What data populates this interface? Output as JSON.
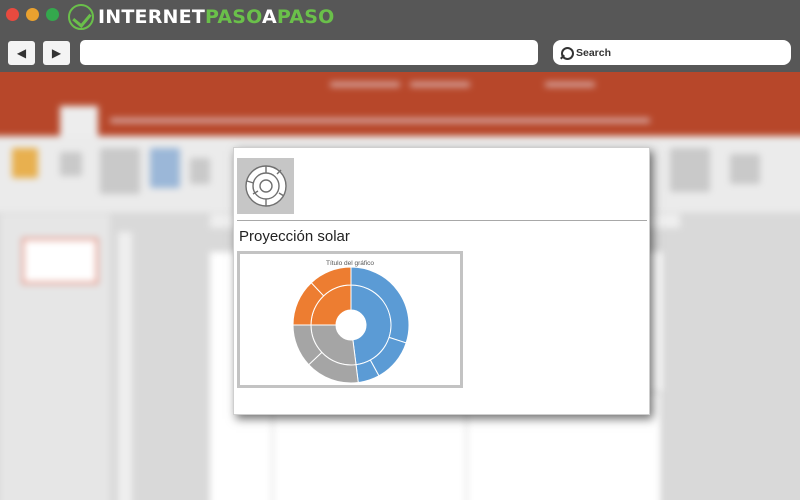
{
  "browser": {
    "logo": {
      "part1": "INTERNET",
      "part2": "PASO",
      "part3": "A",
      "part4": "PASO"
    },
    "nav": {
      "back_icon": "◀",
      "forward_icon": "▶"
    },
    "search": {
      "label": "Search"
    }
  },
  "chart_gallery": {
    "chart_type_icon": "sunburst-icon",
    "section_title": "Proyección solar",
    "preview_chart_title": "Título del gráfico"
  },
  "colors": {
    "accent_blue": "#5b9bd5",
    "accent_orange": "#ed7d31",
    "accent_gray": "#a5a5a5",
    "powerpoint_red": "#b7472a",
    "logo_green": "#6ac04a"
  },
  "chart_data": {
    "type": "sunburst",
    "title": "Título del gráfico",
    "rings": [
      {
        "level": 1,
        "segments": [
          {
            "share": 0.48,
            "color": "#5b9bd5"
          },
          {
            "share": 0.27,
            "color": "#a5a5a5"
          },
          {
            "share": 0.25,
            "color": "#ed7d31"
          }
        ]
      },
      {
        "level": 2,
        "segments": [
          {
            "share": 0.3,
            "color": "#5b9bd5"
          },
          {
            "share": 0.12,
            "color": "#5b9bd5"
          },
          {
            "share": 0.06,
            "color": "#5b9bd5"
          },
          {
            "share": 0.15,
            "color": "#a5a5a5"
          },
          {
            "share": 0.12,
            "color": "#a5a5a5"
          },
          {
            "share": 0.13,
            "color": "#ed7d31"
          },
          {
            "share": 0.12,
            "color": "#ed7d31"
          }
        ]
      }
    ]
  }
}
